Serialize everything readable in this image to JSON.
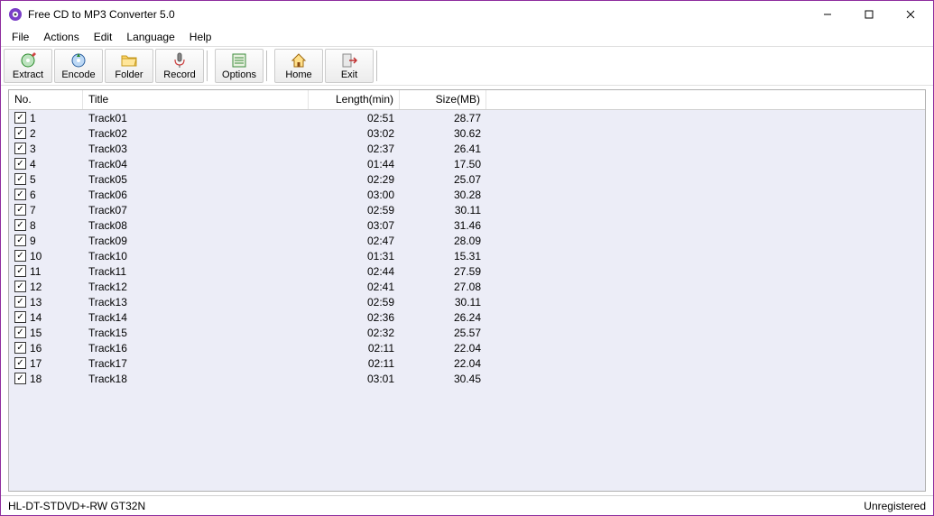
{
  "window": {
    "title": "Free CD to MP3 Converter 5.0"
  },
  "menu": {
    "file": "File",
    "actions": "Actions",
    "edit": "Edit",
    "language": "Language",
    "help": "Help"
  },
  "toolbar": {
    "extract": "Extract",
    "encode": "Encode",
    "folder": "Folder",
    "record": "Record",
    "options": "Options",
    "home": "Home",
    "exit": "Exit"
  },
  "columns": {
    "no": "No.",
    "title": "Title",
    "length": "Length(min)",
    "size": "Size(MB)"
  },
  "tracks": [
    {
      "no": "1",
      "title": "Track01",
      "length": "02:51",
      "size": "28.77"
    },
    {
      "no": "2",
      "title": "Track02",
      "length": "03:02",
      "size": "30.62"
    },
    {
      "no": "3",
      "title": "Track03",
      "length": "02:37",
      "size": "26.41"
    },
    {
      "no": "4",
      "title": "Track04",
      "length": "01:44",
      "size": "17.50"
    },
    {
      "no": "5",
      "title": "Track05",
      "length": "02:29",
      "size": "25.07"
    },
    {
      "no": "6",
      "title": "Track06",
      "length": "03:00",
      "size": "30.28"
    },
    {
      "no": "7",
      "title": "Track07",
      "length": "02:59",
      "size": "30.11"
    },
    {
      "no": "8",
      "title": "Track08",
      "length": "03:07",
      "size": "31.46"
    },
    {
      "no": "9",
      "title": "Track09",
      "length": "02:47",
      "size": "28.09"
    },
    {
      "no": "10",
      "title": "Track10",
      "length": "01:31",
      "size": "15.31"
    },
    {
      "no": "11",
      "title": "Track11",
      "length": "02:44",
      "size": "27.59"
    },
    {
      "no": "12",
      "title": "Track12",
      "length": "02:41",
      "size": "27.08"
    },
    {
      "no": "13",
      "title": "Track13",
      "length": "02:59",
      "size": "30.11"
    },
    {
      "no": "14",
      "title": "Track14",
      "length": "02:36",
      "size": "26.24"
    },
    {
      "no": "15",
      "title": "Track15",
      "length": "02:32",
      "size": "25.57"
    },
    {
      "no": "16",
      "title": "Track16",
      "length": "02:11",
      "size": "22.04"
    },
    {
      "no": "17",
      "title": "Track17",
      "length": "02:11",
      "size": "22.04"
    },
    {
      "no": "18",
      "title": "Track18",
      "length": "03:01",
      "size": "30.45"
    }
  ],
  "status": {
    "device": "HL-DT-STDVD+-RW GT32N",
    "reg": "Unregistered"
  }
}
